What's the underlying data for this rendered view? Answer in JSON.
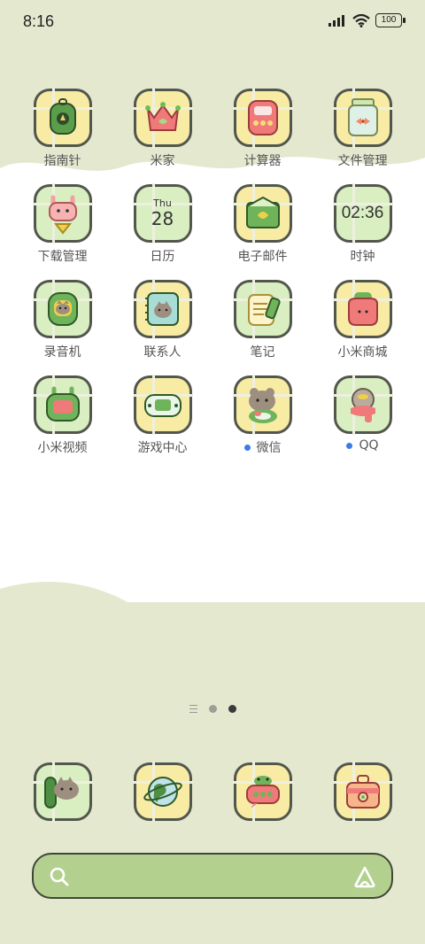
{
  "status_bar": {
    "time": "8:16",
    "battery": "100"
  },
  "apps": [
    {
      "label": "指南针",
      "icon": "compass-backpack-icon",
      "bg": "yellow"
    },
    {
      "label": "米家",
      "icon": "crown-icon",
      "bg": "yellow"
    },
    {
      "label": "计算器",
      "icon": "calculator-icon",
      "bg": "yellow"
    },
    {
      "label": "文件管理",
      "icon": "file-jar-icon",
      "bg": "yellow"
    },
    {
      "label": "下载管理",
      "icon": "bunny-download-icon",
      "bg": "green"
    },
    {
      "label": "日历",
      "icon": "calendar-icon",
      "bg": "green",
      "weekday": "Thu",
      "day": "28"
    },
    {
      "label": "电子邮件",
      "icon": "envelope-icon",
      "bg": "yellow"
    },
    {
      "label": "时钟",
      "icon": "clock-icon",
      "bg": "green",
      "clock": "02:36"
    },
    {
      "label": "录音机",
      "icon": "cat-recorder-icon",
      "bg": "green"
    },
    {
      "label": "联系人",
      "icon": "cat-contacts-icon",
      "bg": "yellow"
    },
    {
      "label": "笔记",
      "icon": "notes-icon",
      "bg": "green"
    },
    {
      "label": "小米商城",
      "icon": "shopping-bag-icon",
      "bg": "yellow"
    },
    {
      "label": "小米视频",
      "icon": "tv-bunny-icon",
      "bg": "green"
    },
    {
      "label": "游戏中心",
      "icon": "game-controller-icon",
      "bg": "yellow"
    },
    {
      "label": "微信",
      "icon": "bear-chat-icon",
      "bg": "yellow",
      "badge": true
    },
    {
      "label": "QQ",
      "icon": "penguin-scarf-icon",
      "bg": "green",
      "badge": true
    }
  ],
  "dock": [
    {
      "label": "phone",
      "icon": "cat-phone-icon",
      "bg": "green"
    },
    {
      "label": "browser",
      "icon": "globe-icon",
      "bg": "yellow"
    },
    {
      "label": "messages",
      "icon": "frog-messages-icon",
      "bg": "yellow"
    },
    {
      "label": "app store",
      "icon": "toolbox-icon",
      "bg": "yellow"
    }
  ],
  "search": {
    "placeholder": ""
  },
  "colors": {
    "yellow": "#f8eca5",
    "green": "#d9efc2",
    "search_bar": "#b3d08f",
    "background": "#e4e8cf"
  }
}
